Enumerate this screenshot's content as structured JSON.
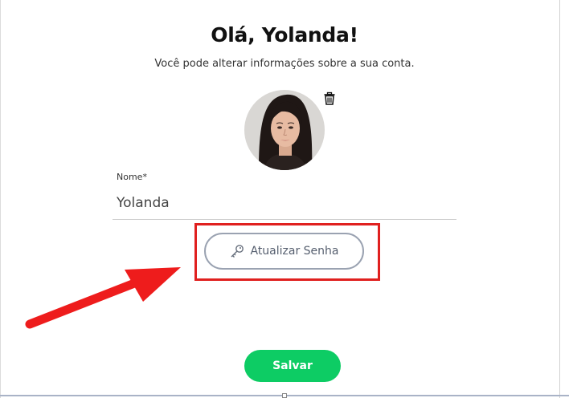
{
  "header": {
    "title": "Olá, Yolanda!",
    "subtitle": "Você pode alterar informações sobre a sua conta."
  },
  "profile": {
    "avatar_icon": "user-photo",
    "delete_icon": "trash-icon"
  },
  "form": {
    "name_label": "Nome*",
    "name_value": "Yolanda"
  },
  "actions": {
    "update_password_label": "Atualizar Senha",
    "update_password_icon": "key-icon",
    "save_label": "Salvar"
  },
  "annotation": {
    "highlight_color": "#e0201f",
    "arrow_color": "#ee1c1c"
  },
  "colors": {
    "save_button": "#0dcc64",
    "outline_button_border": "#9aa2b1"
  }
}
